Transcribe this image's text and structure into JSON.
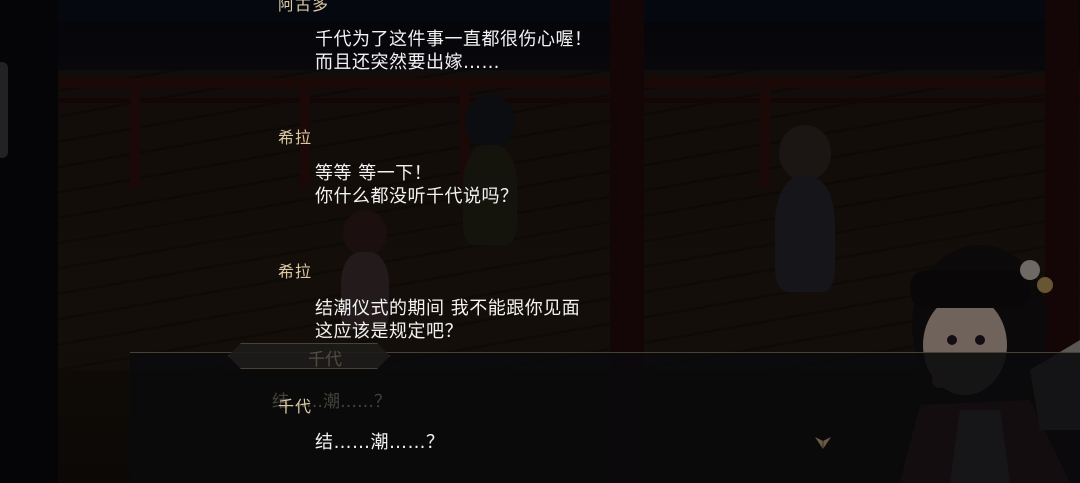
{
  "dialogue_log": [
    {
      "speaker": "阿古多",
      "lines": [
        "千代为了这件事一直都很伤心喔！",
        "而且还突然要出嫁……"
      ]
    },
    {
      "speaker": "希拉",
      "lines": [
        "等等 等一下！",
        "你什么都没听千代说吗？"
      ]
    },
    {
      "speaker": "希拉",
      "lines": [
        "结潮仪式的期间 我不能跟你见面",
        "这应该是规定吧？"
      ]
    },
    {
      "speaker": "千代",
      "lines": [
        "结……潮……？"
      ]
    }
  ],
  "background_textbox": {
    "speaker": "千代",
    "text": "结……潮……？"
  },
  "icons": {
    "advance": "chevron-down-icon"
  },
  "colors": {
    "speaker_name": "#d9c9a3",
    "dialogue_text": "#f2f2f2"
  }
}
